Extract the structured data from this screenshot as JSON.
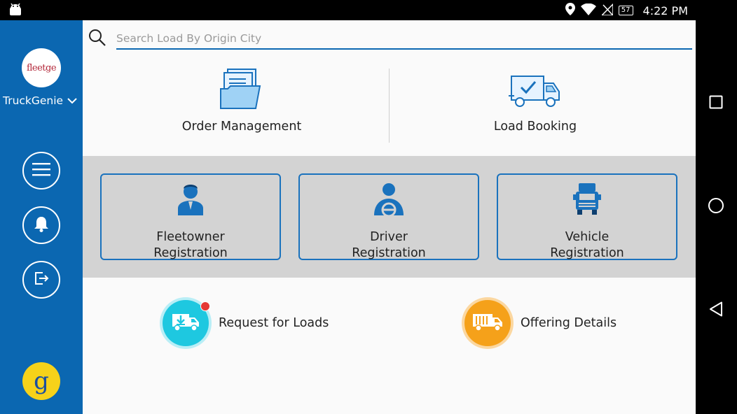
{
  "status_bar": {
    "battery": "57",
    "time": "4:22 PM",
    "icons": [
      "android-icon",
      "location-icon",
      "wifi-icon",
      "no-signal-icon",
      "battery-icon"
    ]
  },
  "sidebar": {
    "logo_text": "fleetge",
    "brand": "TruckGenie",
    "buttons": [
      "menu-icon",
      "bell-icon",
      "logout-icon"
    ],
    "bottom_logo_text": "g",
    "colors": {
      "background": "#0b67b1",
      "bottom_logo": "#f6d21a"
    }
  },
  "search": {
    "placeholder": "Search Load By Origin City",
    "value": ""
  },
  "top_tiles": [
    {
      "label": "Order Management",
      "icon": "documents-folder-icon"
    },
    {
      "label": "Load Booking",
      "icon": "truck-check-icon"
    }
  ],
  "registration": [
    {
      "line1": "Fleetowner",
      "line2": "Registration",
      "icon": "fleetowner-person-icon"
    },
    {
      "line1": "Driver",
      "line2": "Registration",
      "icon": "driver-steering-icon"
    },
    {
      "line1": "Vehicle",
      "line2": "Registration",
      "icon": "vehicle-truck-front-icon"
    }
  ],
  "actions": [
    {
      "label": "Request for Loads",
      "icon": "download-truck-icon",
      "color": "#1ec8e0",
      "has_badge": true
    },
    {
      "label": "Offering Details",
      "icon": "cargo-truck-icon",
      "color": "#f5a11a",
      "has_badge": false
    }
  ],
  "nav_bar": [
    "recents-square-icon",
    "home-circle-icon",
    "back-triangle-icon"
  ]
}
